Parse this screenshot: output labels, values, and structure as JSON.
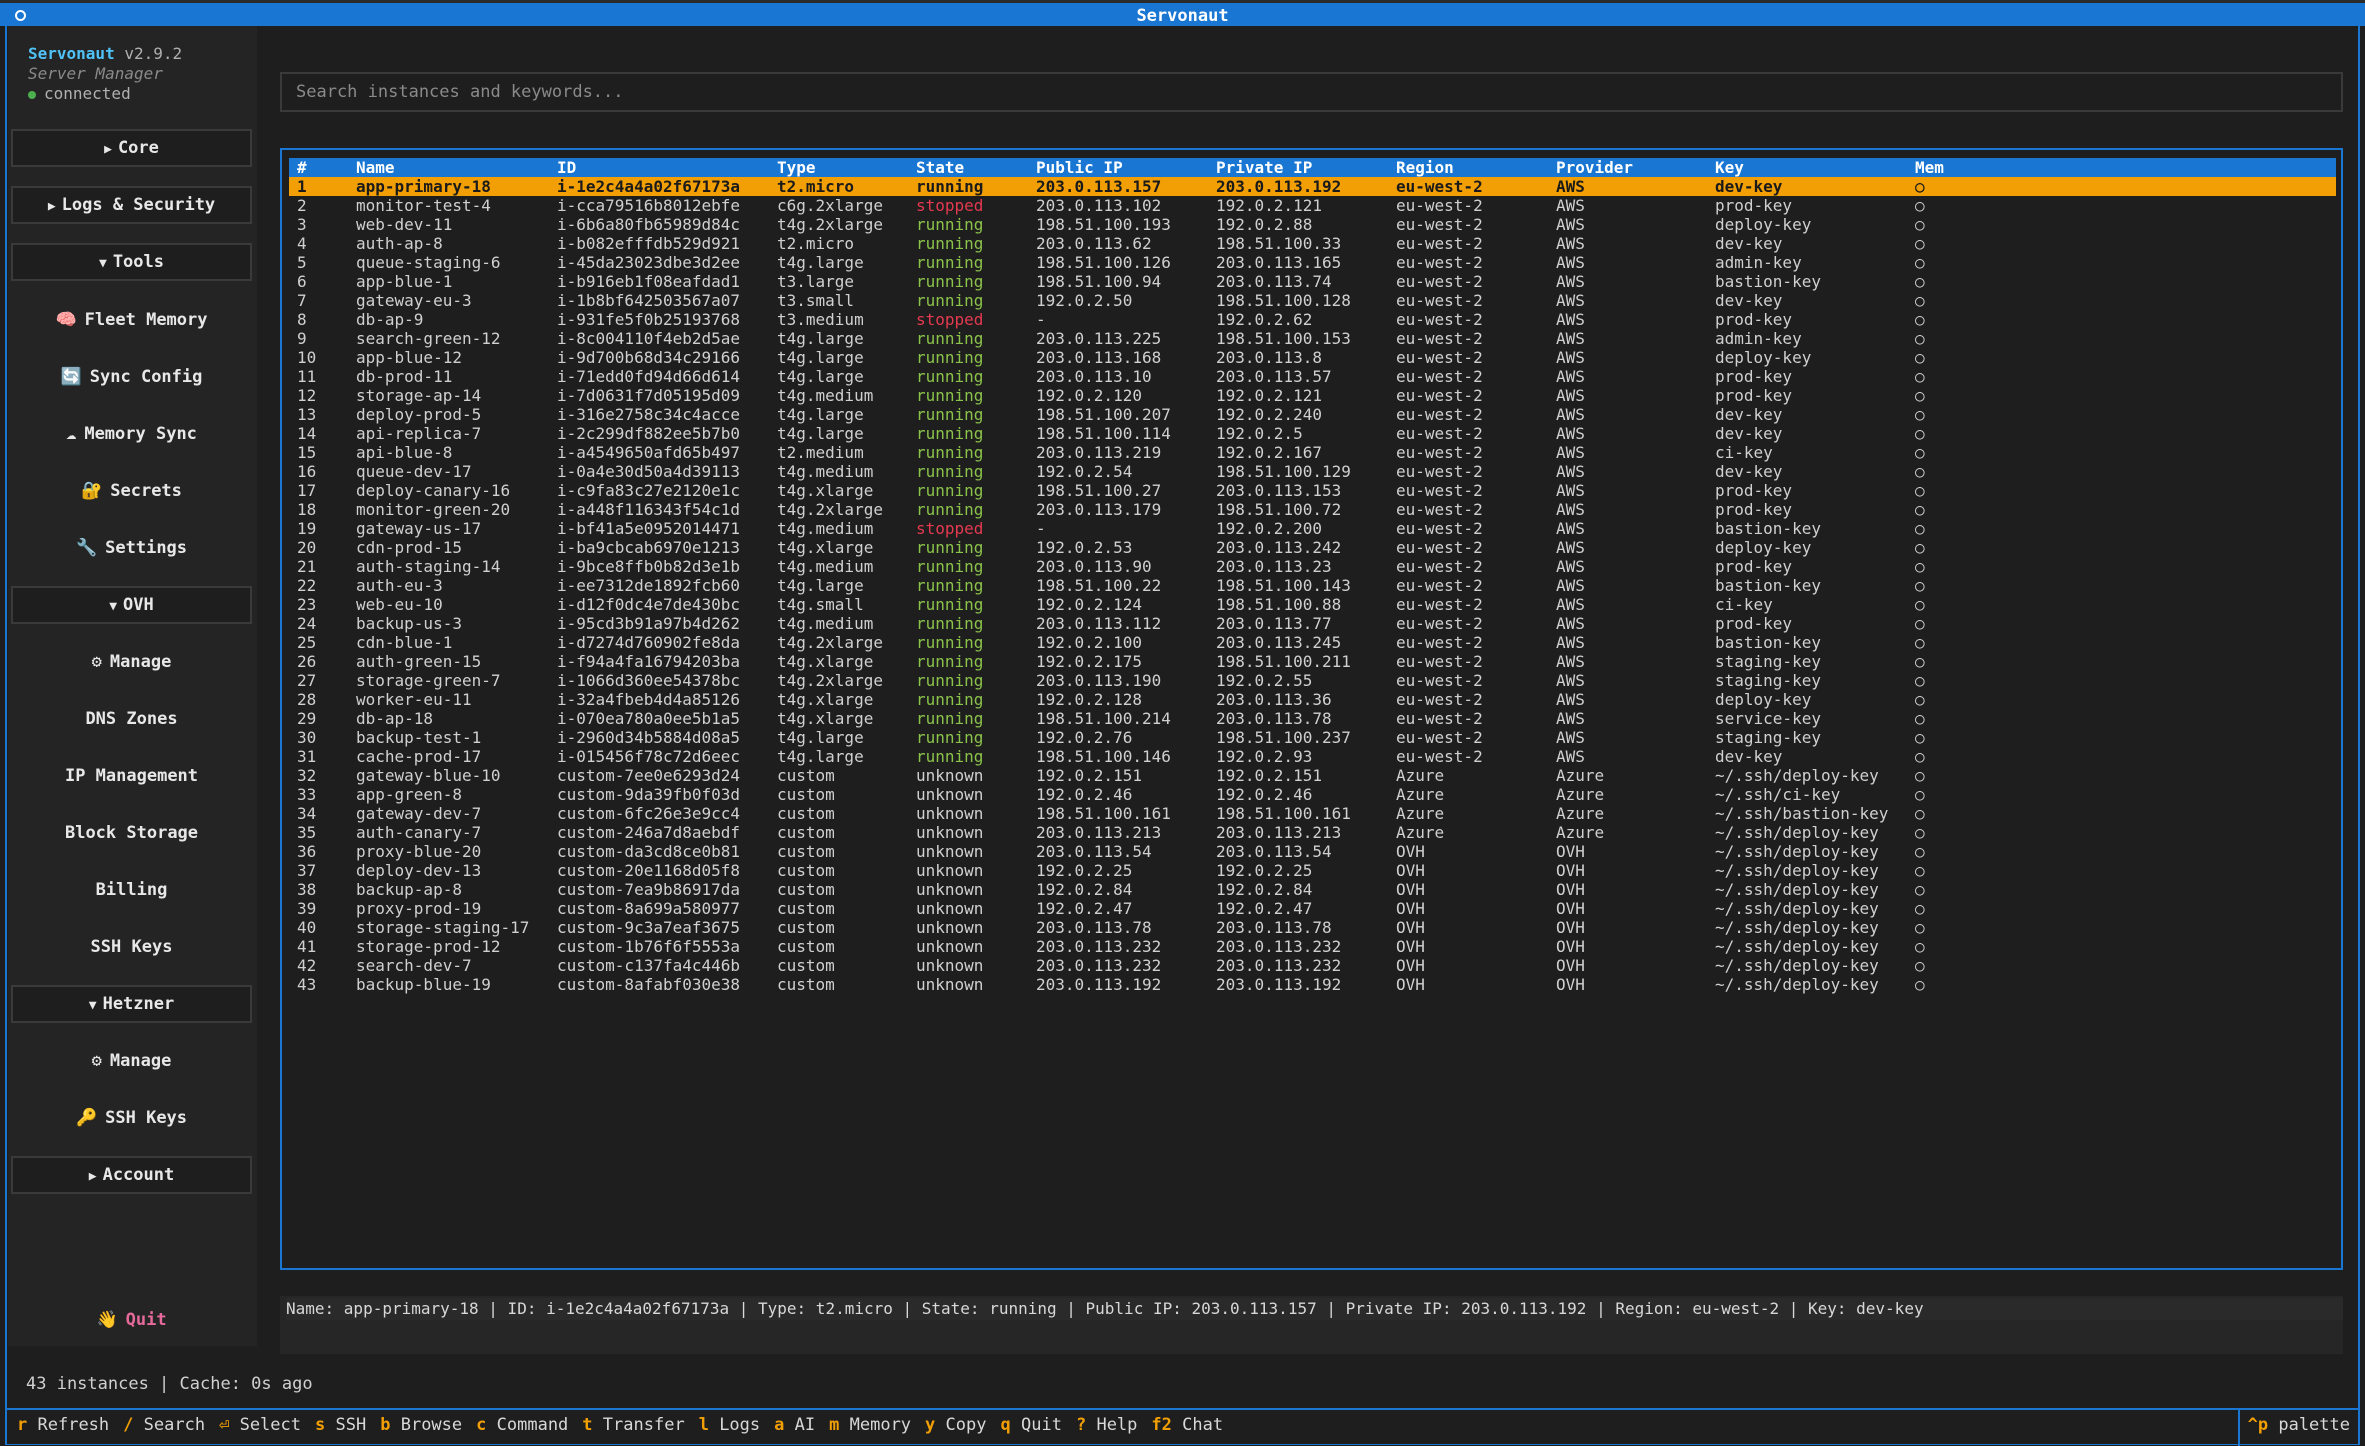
{
  "window": {
    "title": "Servonaut"
  },
  "brand": {
    "name": "Servonaut",
    "version": "v2.9.2",
    "subtitle": "Server Manager",
    "connection": "connected"
  },
  "sidebar": {
    "core": "Core",
    "logs_security": "Logs & Security",
    "tools": "Tools",
    "tools_items": [
      {
        "icon": "🧠",
        "label": "Fleet Memory"
      },
      {
        "icon": "🔄",
        "label": "Sync Config"
      },
      {
        "icon": "☁",
        "label": "Memory Sync"
      },
      {
        "icon": "🔐",
        "label": "Secrets"
      },
      {
        "icon": "🔧",
        "label": "Settings"
      }
    ],
    "ovh": "OVH",
    "ovh_items": [
      {
        "icon": "⚙",
        "label": "Manage"
      },
      {
        "icon": "",
        "label": "DNS Zones"
      },
      {
        "icon": "",
        "label": "IP Management"
      },
      {
        "icon": "",
        "label": "Block Storage"
      },
      {
        "icon": "",
        "label": "Billing"
      },
      {
        "icon": "",
        "label": "SSH Keys"
      }
    ],
    "hetzner": "Hetzner",
    "hetzner_items": [
      {
        "icon": "⚙",
        "label": "Manage"
      },
      {
        "icon": "🔑",
        "label": "SSH Keys"
      }
    ],
    "account": "Account",
    "quit_icon": "👋",
    "quit": "Quit"
  },
  "search": {
    "placeholder": "Search instances and keywords..."
  },
  "table": {
    "columns": [
      "#",
      "Name",
      "ID",
      "Type",
      "State",
      "Public IP",
      "Private IP",
      "Region",
      "Provider",
      "Key",
      "Mem"
    ],
    "selected_index": 0,
    "mem_symbol": "○",
    "rows": [
      [
        "1",
        "app-primary-18",
        "i-1e2c4a4a02f67173a",
        "t2.micro",
        "running",
        "203.0.113.157",
        "203.0.113.192",
        "eu-west-2",
        "AWS",
        "dev-key"
      ],
      [
        "2",
        "monitor-test-4",
        "i-cca79516b8012ebfe",
        "c6g.2xlarge",
        "stopped",
        "203.0.113.102",
        "192.0.2.121",
        "eu-west-2",
        "AWS",
        "prod-key"
      ],
      [
        "3",
        "web-dev-11",
        "i-6b6a80fb65989d84c",
        "t4g.2xlarge",
        "running",
        "198.51.100.193",
        "192.0.2.88",
        "eu-west-2",
        "AWS",
        "deploy-key"
      ],
      [
        "4",
        "auth-ap-8",
        "i-b082efffdb529d921",
        "t2.micro",
        "running",
        "203.0.113.62",
        "198.51.100.33",
        "eu-west-2",
        "AWS",
        "dev-key"
      ],
      [
        "5",
        "queue-staging-6",
        "i-45da23023dbe3d2ee",
        "t4g.large",
        "running",
        "198.51.100.126",
        "203.0.113.165",
        "eu-west-2",
        "AWS",
        "admin-key"
      ],
      [
        "6",
        "app-blue-1",
        "i-b916eb1f08eafdad1",
        "t3.large",
        "running",
        "198.51.100.94",
        "203.0.113.74",
        "eu-west-2",
        "AWS",
        "bastion-key"
      ],
      [
        "7",
        "gateway-eu-3",
        "i-1b8bf642503567a07",
        "t3.small",
        "running",
        "192.0.2.50",
        "198.51.100.128",
        "eu-west-2",
        "AWS",
        "dev-key"
      ],
      [
        "8",
        "db-ap-9",
        "i-931fe5f0b25193768",
        "t3.medium",
        "stopped",
        "-",
        "192.0.2.62",
        "eu-west-2",
        "AWS",
        "prod-key"
      ],
      [
        "9",
        "search-green-12",
        "i-8c004110f4eb2d5ae",
        "t4g.large",
        "running",
        "203.0.113.225",
        "198.51.100.153",
        "eu-west-2",
        "AWS",
        "admin-key"
      ],
      [
        "10",
        "app-blue-12",
        "i-9d700b68d34c29166",
        "t4g.large",
        "running",
        "203.0.113.168",
        "203.0.113.8",
        "eu-west-2",
        "AWS",
        "deploy-key"
      ],
      [
        "11",
        "db-prod-11",
        "i-71edd0fd94d66d614",
        "t4g.large",
        "running",
        "203.0.113.10",
        "203.0.113.57",
        "eu-west-2",
        "AWS",
        "prod-key"
      ],
      [
        "12",
        "storage-ap-14",
        "i-7d0631f7d05195d09",
        "t4g.medium",
        "running",
        "192.0.2.120",
        "192.0.2.121",
        "eu-west-2",
        "AWS",
        "prod-key"
      ],
      [
        "13",
        "deploy-prod-5",
        "i-316e2758c34c4acce",
        "t4g.large",
        "running",
        "198.51.100.207",
        "192.0.2.240",
        "eu-west-2",
        "AWS",
        "dev-key"
      ],
      [
        "14",
        "api-replica-7",
        "i-2c299df882ee5b7b0",
        "t4g.large",
        "running",
        "198.51.100.114",
        "192.0.2.5",
        "eu-west-2",
        "AWS",
        "dev-key"
      ],
      [
        "15",
        "api-blue-8",
        "i-a4549650afd65b497",
        "t2.medium",
        "running",
        "203.0.113.219",
        "192.0.2.167",
        "eu-west-2",
        "AWS",
        "ci-key"
      ],
      [
        "16",
        "queue-dev-17",
        "i-0a4e30d50a4d39113",
        "t4g.medium",
        "running",
        "192.0.2.54",
        "198.51.100.129",
        "eu-west-2",
        "AWS",
        "dev-key"
      ],
      [
        "17",
        "deploy-canary-16",
        "i-c9fa83c27e2120e1c",
        "t4g.xlarge",
        "running",
        "198.51.100.27",
        "203.0.113.153",
        "eu-west-2",
        "AWS",
        "prod-key"
      ],
      [
        "18",
        "monitor-green-20",
        "i-a448f116343f54c1d",
        "t4g.2xlarge",
        "running",
        "203.0.113.179",
        "198.51.100.72",
        "eu-west-2",
        "AWS",
        "prod-key"
      ],
      [
        "19",
        "gateway-us-17",
        "i-bf41a5e0952014471",
        "t4g.medium",
        "stopped",
        "-",
        "192.0.2.200",
        "eu-west-2",
        "AWS",
        "bastion-key"
      ],
      [
        "20",
        "cdn-prod-15",
        "i-ba9cbcab6970e1213",
        "t4g.xlarge",
        "running",
        "192.0.2.53",
        "203.0.113.242",
        "eu-west-2",
        "AWS",
        "deploy-key"
      ],
      [
        "21",
        "auth-staging-14",
        "i-9bce8ffb0b82d3e1b",
        "t4g.medium",
        "running",
        "203.0.113.90",
        "203.0.113.23",
        "eu-west-2",
        "AWS",
        "prod-key"
      ],
      [
        "22",
        "auth-eu-3",
        "i-ee7312de1892fcb60",
        "t4g.large",
        "running",
        "198.51.100.22",
        "198.51.100.143",
        "eu-west-2",
        "AWS",
        "bastion-key"
      ],
      [
        "23",
        "web-eu-10",
        "i-d12f0dc4e7de430bc",
        "t4g.small",
        "running",
        "192.0.2.124",
        "198.51.100.88",
        "eu-west-2",
        "AWS",
        "ci-key"
      ],
      [
        "24",
        "backup-us-3",
        "i-95cd3b91a97b4d262",
        "t4g.medium",
        "running",
        "203.0.113.112",
        "203.0.113.77",
        "eu-west-2",
        "AWS",
        "prod-key"
      ],
      [
        "25",
        "cdn-blue-1",
        "i-d7274d760902fe8da",
        "t4g.2xlarge",
        "running",
        "192.0.2.100",
        "203.0.113.245",
        "eu-west-2",
        "AWS",
        "bastion-key"
      ],
      [
        "26",
        "auth-green-15",
        "i-f94a4fa16794203ba",
        "t4g.xlarge",
        "running",
        "192.0.2.175",
        "198.51.100.211",
        "eu-west-2",
        "AWS",
        "staging-key"
      ],
      [
        "27",
        "storage-green-7",
        "i-1066d360ee54378bc",
        "t4g.2xlarge",
        "running",
        "203.0.113.190",
        "192.0.2.55",
        "eu-west-2",
        "AWS",
        "staging-key"
      ],
      [
        "28",
        "worker-eu-11",
        "i-32a4fbeb4d4a85126",
        "t4g.xlarge",
        "running",
        "192.0.2.128",
        "203.0.113.36",
        "eu-west-2",
        "AWS",
        "deploy-key"
      ],
      [
        "29",
        "db-ap-18",
        "i-070ea780a0ee5b1a5",
        "t4g.xlarge",
        "running",
        "198.51.100.214",
        "203.0.113.78",
        "eu-west-2",
        "AWS",
        "service-key"
      ],
      [
        "30",
        "backup-test-1",
        "i-2960d34b5884d08a5",
        "t4g.large",
        "running",
        "192.0.2.76",
        "198.51.100.237",
        "eu-west-2",
        "AWS",
        "staging-key"
      ],
      [
        "31",
        "cache-prod-17",
        "i-015456f78c72d6eec",
        "t4g.large",
        "running",
        "198.51.100.146",
        "192.0.2.93",
        "eu-west-2",
        "AWS",
        "dev-key"
      ],
      [
        "32",
        "gateway-blue-10",
        "custom-7ee0e6293d24",
        "custom",
        "unknown",
        "192.0.2.151",
        "192.0.2.151",
        "Azure",
        "Azure",
        "~/.ssh/deploy-key"
      ],
      [
        "33",
        "app-green-8",
        "custom-9da39fb0f03d",
        "custom",
        "unknown",
        "192.0.2.46",
        "192.0.2.46",
        "Azure",
        "Azure",
        "~/.ssh/ci-key"
      ],
      [
        "34",
        "gateway-dev-7",
        "custom-6fc26e3e9cc4",
        "custom",
        "unknown",
        "198.51.100.161",
        "198.51.100.161",
        "Azure",
        "Azure",
        "~/.ssh/bastion-key"
      ],
      [
        "35",
        "auth-canary-7",
        "custom-246a7d8aebdf",
        "custom",
        "unknown",
        "203.0.113.213",
        "203.0.113.213",
        "Azure",
        "Azure",
        "~/.ssh/deploy-key"
      ],
      [
        "36",
        "proxy-blue-20",
        "custom-da3cd8ce0b81",
        "custom",
        "unknown",
        "203.0.113.54",
        "203.0.113.54",
        "OVH",
        "OVH",
        "~/.ssh/deploy-key"
      ],
      [
        "37",
        "deploy-dev-13",
        "custom-20e1168d05f8",
        "custom",
        "unknown",
        "192.0.2.25",
        "192.0.2.25",
        "OVH",
        "OVH",
        "~/.ssh/deploy-key"
      ],
      [
        "38",
        "backup-ap-8",
        "custom-7ea9b86917da",
        "custom",
        "unknown",
        "192.0.2.84",
        "192.0.2.84",
        "OVH",
        "OVH",
        "~/.ssh/deploy-key"
      ],
      [
        "39",
        "proxy-prod-19",
        "custom-8a699a580977",
        "custom",
        "unknown",
        "192.0.2.47",
        "192.0.2.47",
        "OVH",
        "OVH",
        "~/.ssh/deploy-key"
      ],
      [
        "40",
        "storage-staging-17",
        "custom-9c3a7eaf3675",
        "custom",
        "unknown",
        "203.0.113.78",
        "203.0.113.78",
        "OVH",
        "OVH",
        "~/.ssh/deploy-key"
      ],
      [
        "41",
        "storage-prod-12",
        "custom-1b76f6f5553a",
        "custom",
        "unknown",
        "203.0.113.232",
        "203.0.113.232",
        "OVH",
        "OVH",
        "~/.ssh/deploy-key"
      ],
      [
        "42",
        "search-dev-7",
        "custom-c137fa4c446b",
        "custom",
        "unknown",
        "203.0.113.232",
        "203.0.113.232",
        "OVH",
        "OVH",
        "~/.ssh/deploy-key"
      ],
      [
        "43",
        "backup-blue-19",
        "custom-8afabf030e38",
        "custom",
        "unknown",
        "203.0.113.192",
        "203.0.113.192",
        "OVH",
        "OVH",
        "~/.ssh/deploy-key"
      ]
    ]
  },
  "detail": {
    "text": "Name: app-primary-18  |  ID: i-1e2c4a4a02f67173a  |  Type: t2.micro  |  State: running  |  Public IP: 203.0.113.157  |  Private IP: 203.0.113.192  |  Region: eu-west-2  |  Key: dev-key"
  },
  "status": {
    "text": "43 instances | Cache: 0s ago"
  },
  "footer": {
    "keys": [
      {
        "key": "r",
        "label": "Refresh"
      },
      {
        "key": "/",
        "label": "Search"
      },
      {
        "key": "⏎",
        "label": "Select"
      },
      {
        "key": "s",
        "label": "SSH"
      },
      {
        "key": "b",
        "label": "Browse"
      },
      {
        "key": "c",
        "label": "Command"
      },
      {
        "key": "t",
        "label": "Transfer"
      },
      {
        "key": "l",
        "label": "Logs"
      },
      {
        "key": "a",
        "label": "AI"
      },
      {
        "key": "m",
        "label": "Memory"
      },
      {
        "key": "y",
        "label": "Copy"
      },
      {
        "key": "q",
        "label": "Quit"
      },
      {
        "key": "?",
        "label": "Help"
      },
      {
        "key": "f2",
        "label": "Chat"
      }
    ],
    "palette_key": "^p",
    "palette_label": "palette"
  },
  "colors": {
    "accent": "#1976d2",
    "selected": "#f29f05",
    "running": "#8bc34a",
    "stopped": "#e53950",
    "brand": "#4fc3f7"
  }
}
